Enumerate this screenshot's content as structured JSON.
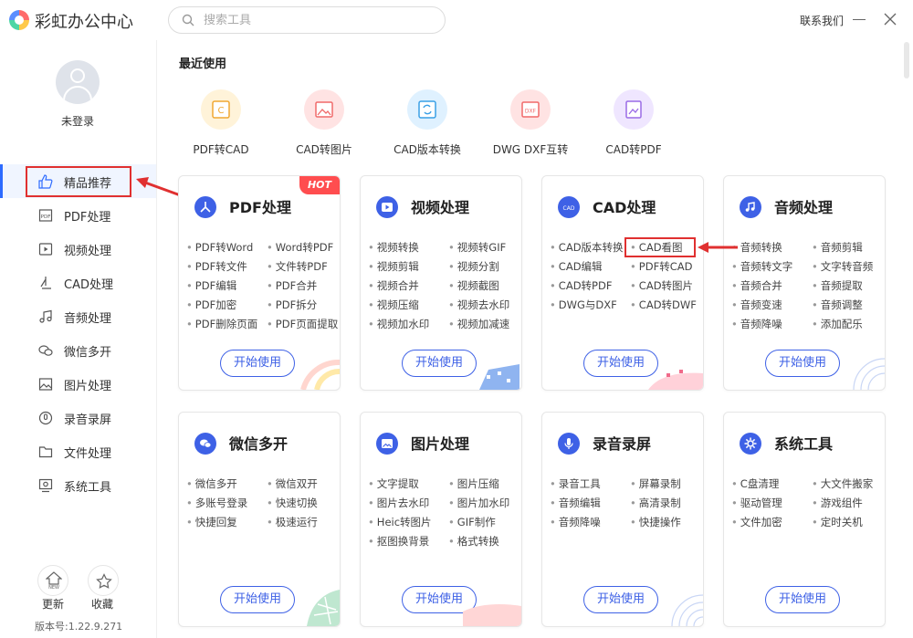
{
  "app": {
    "title": "彩虹办公中心"
  },
  "search": {
    "placeholder": "搜索工具"
  },
  "topbar": {
    "contact": "联系我们"
  },
  "user": {
    "login_status": "未登录"
  },
  "sidebar": {
    "items": [
      {
        "label": "精品推荐",
        "icon": "thumbs-up-icon"
      },
      {
        "label": "PDF处理",
        "icon": "pdf-icon"
      },
      {
        "label": "视频处理",
        "icon": "video-icon"
      },
      {
        "label": "CAD处理",
        "icon": "cad-icon"
      },
      {
        "label": "音频处理",
        "icon": "music-icon"
      },
      {
        "label": "微信多开",
        "icon": "wechat-icon"
      },
      {
        "label": "图片处理",
        "icon": "image-icon"
      },
      {
        "label": "录音录屏",
        "icon": "record-icon"
      },
      {
        "label": "文件处理",
        "icon": "folder-icon"
      },
      {
        "label": "系统工具",
        "icon": "system-icon"
      }
    ],
    "update_label": "更新",
    "favorite_label": "收藏",
    "version": "版本号:1.22.9.271"
  },
  "recent": {
    "title": "最近使用",
    "items": [
      {
        "label": "PDF转CAD",
        "color": "#fff3d9"
      },
      {
        "label": "CAD转图片",
        "color": "#ffe3e3"
      },
      {
        "label": "CAD版本转换",
        "color": "#dff1ff"
      },
      {
        "label": "DWG DXF互转",
        "color": "#ffe3e3"
      },
      {
        "label": "CAD转PDF",
        "color": "#efe6ff"
      }
    ]
  },
  "cards": [
    {
      "title": "PDF处理",
      "badge": "HOT",
      "items": [
        "PDF转Word",
        "Word转PDF",
        "PDF转文件",
        "文件转PDF",
        "PDF编辑",
        "PDF合并",
        "PDF加密",
        "PDF拆分",
        "PDF删除页面",
        "PDF页面提取"
      ],
      "button": "开始使用"
    },
    {
      "title": "视频处理",
      "items": [
        "视频转换",
        "视频转GIF",
        "视频剪辑",
        "视频分割",
        "视频合并",
        "视频截图",
        "视频压缩",
        "视频去水印",
        "视频加水印",
        "视频加减速"
      ],
      "button": "开始使用"
    },
    {
      "title": "CAD处理",
      "items": [
        "CAD版本转换",
        "CAD看图",
        "CAD编辑",
        "PDF转CAD",
        "CAD转PDF",
        "CAD转图片",
        "DWG与DXF",
        "CAD转DWF"
      ],
      "button": "开始使用"
    },
    {
      "title": "音频处理",
      "items": [
        "音频转换",
        "音频剪辑",
        "音频转文字",
        "文字转音频",
        "音频合并",
        "音频提取",
        "音频变速",
        "音频调整",
        "音频降噪",
        "添加配乐"
      ],
      "button": "开始使用"
    },
    {
      "title": "微信多开",
      "items": [
        "微信多开",
        "微信双开",
        "多账号登录",
        "快速切换",
        "快捷回复",
        "极速运行"
      ],
      "button": "开始使用"
    },
    {
      "title": "图片处理",
      "items": [
        "文字提取",
        "图片压缩",
        "图片去水印",
        "图片加水印",
        "Heic转图片",
        "GIF制作",
        "抠图换背景",
        "格式转换"
      ],
      "button": "开始使用"
    },
    {
      "title": "录音录屏",
      "items": [
        "录音工具",
        "屏幕录制",
        "音频编辑",
        "高清录制",
        "音频降噪",
        "快捷操作"
      ],
      "button": "开始使用"
    },
    {
      "title": "系统工具",
      "items": [
        "C盘清理",
        "大文件搬家",
        "驱动管理",
        "游戏组件",
        "文件加密",
        "定时关机"
      ],
      "button": "开始使用"
    }
  ],
  "colors": {
    "accent": "#3e61e6",
    "highlight": "#e03030",
    "hot": "#ff4d4f"
  }
}
